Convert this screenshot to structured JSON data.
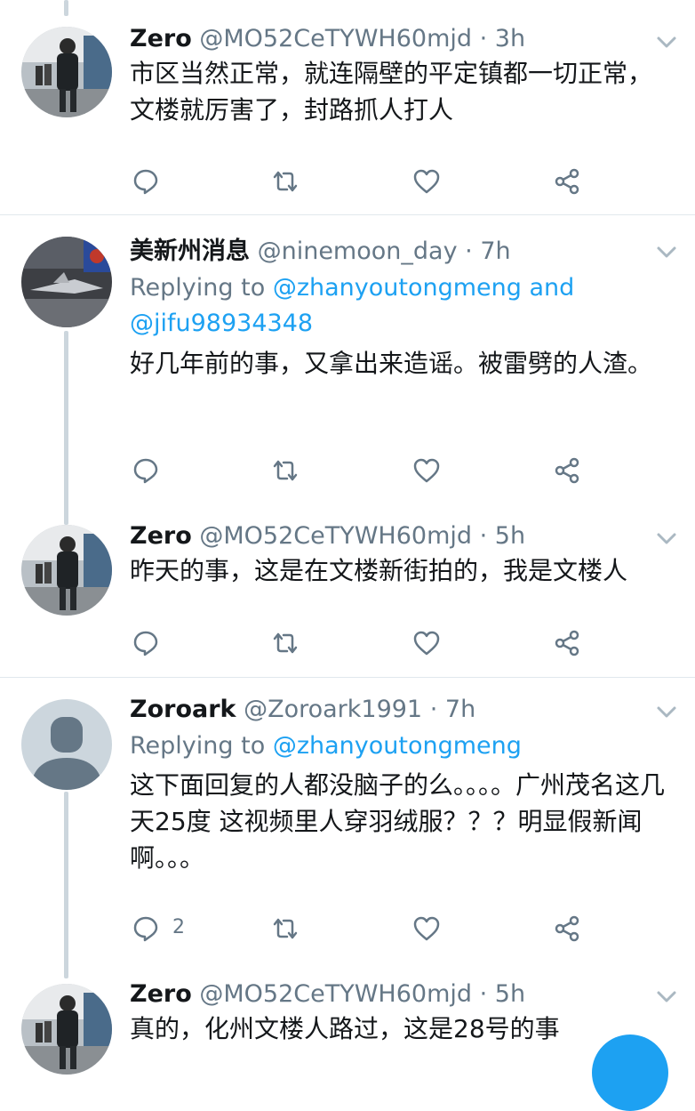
{
  "tweets": [
    {
      "name": "Zero",
      "handle": "@MO52CeTYWH60mjd",
      "dot": "·",
      "time": "3h",
      "text": "市区当然正常，就连隔壁的平定镇都一切正常，文楼就厉害了，封路抓人打人",
      "avatar": "photo-man-street"
    },
    {
      "name": "美新州消息",
      "handle": "@ninemoon_day",
      "dot": "·",
      "time": "7h",
      "reply_prefix": "Replying to",
      "reply_users": "@zhanyoutongmeng",
      "reply_and": "and",
      "reply_users2": "@jifu98934348",
      "text": "好几年前的事，又拿出来造谣。被雷劈的人渣。",
      "avatar": "photo-aircraft-model"
    },
    {
      "name": "Zero",
      "handle": "@MO52CeTYWH60mjd",
      "dot": "·",
      "time": "5h",
      "text": "昨天的事，这是在文楼新街拍的，我是文楼人",
      "avatar": "photo-man-street"
    },
    {
      "name": "Zoroark",
      "handle": "@Zoroark1991",
      "dot": "·",
      "time": "7h",
      "reply_prefix": "Replying to",
      "reply_users": "@zhanyoutongmeng",
      "text": "这下面回复的人都没脑子的么。。。。广州茂名这几天25度 这视频里人穿羽绒服？？？明显假新闻啊。。。",
      "reply_count": "2",
      "avatar": "default-avatar"
    },
    {
      "name": "Zero",
      "handle": "@MO52CeTYWH60mjd",
      "dot": "·",
      "time": "5h",
      "text": "真的，化州文楼人路过，这是28号的事",
      "avatar": "photo-man-street"
    }
  ],
  "actions": [
    "reply-icon",
    "retweet-icon",
    "like-icon",
    "share-icon"
  ],
  "colors": {
    "link": "#1da1f2",
    "secondary": "#657786",
    "icon": "#657786",
    "thread": "#ccd6dd"
  }
}
